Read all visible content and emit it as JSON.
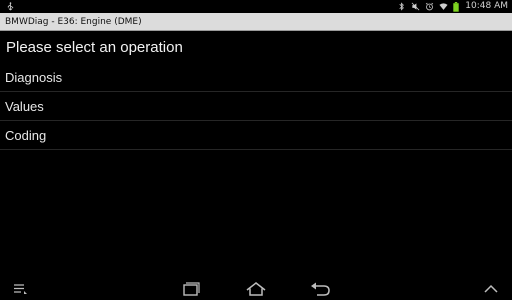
{
  "status_bar": {
    "time": "10:48 AM",
    "icons": [
      "usb-icon",
      "bluetooth-icon",
      "mute-icon",
      "alarm-icon",
      "wifi-icon",
      "battery-icon"
    ]
  },
  "app": {
    "title": "BMWDiag - E36: Engine (DME)"
  },
  "main": {
    "heading": "Please select an operation",
    "items": [
      {
        "label": "Diagnosis"
      },
      {
        "label": "Values"
      },
      {
        "label": "Coding"
      }
    ]
  },
  "nav_bar": {
    "buttons": [
      "menu-icon",
      "recent-apps-icon",
      "home-icon",
      "back-icon",
      "expand-up-icon"
    ]
  },
  "colors": {
    "background": "#000000",
    "title_bar": "#dcdcdc",
    "battery": "#7ed321"
  }
}
